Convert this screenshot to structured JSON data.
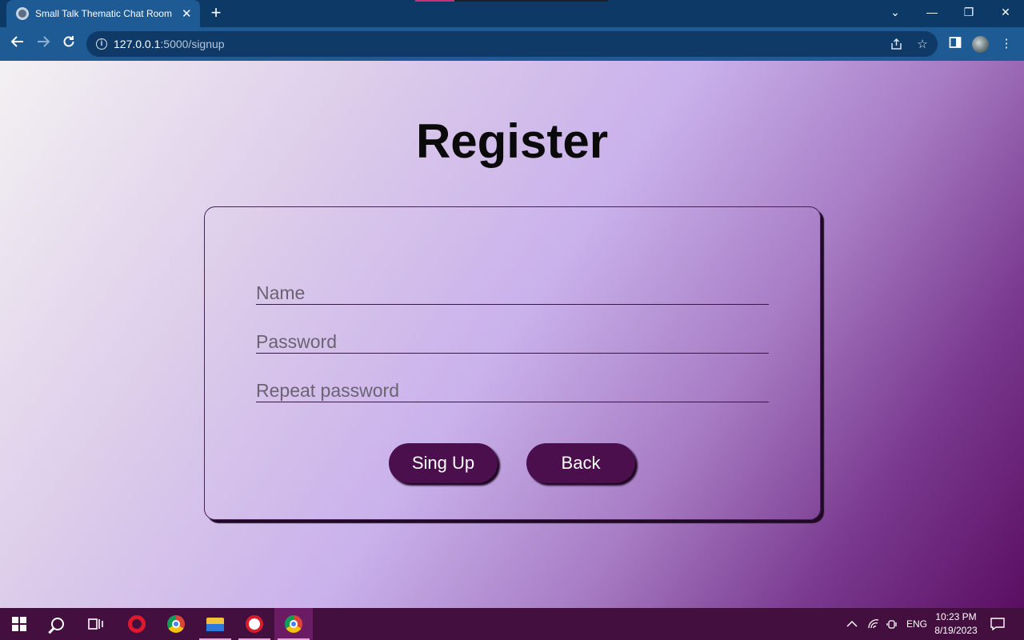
{
  "browser": {
    "tab_title": "Small Talk Thematic Chat Room",
    "tab_close": "✕",
    "new_tab": "+",
    "url_host": "127.0.0.1",
    "url_path": ":5000/signup",
    "window_controls": {
      "minimize": "—",
      "restore": "❐",
      "close": "✕",
      "tab_search": "⌄"
    }
  },
  "page": {
    "title": "Register",
    "form": {
      "name_placeholder": "Name",
      "password_placeholder": "Password",
      "repeat_placeholder": "Repeat password",
      "signup_label": "Sing Up",
      "back_label": "Back"
    }
  },
  "taskbar": {
    "language": "ENG",
    "time": "10:23 PM",
    "date": "8/19/2023",
    "apps": [
      "start",
      "search",
      "task-view",
      "opera",
      "chrome",
      "file-explorer",
      "red-app",
      "chrome-profile"
    ]
  },
  "colors": {
    "button_bg": "#4b0f4e",
    "tab_active": "#1e5a93",
    "tabstrip": "#0d3966",
    "taskbar": "#430f3f"
  }
}
